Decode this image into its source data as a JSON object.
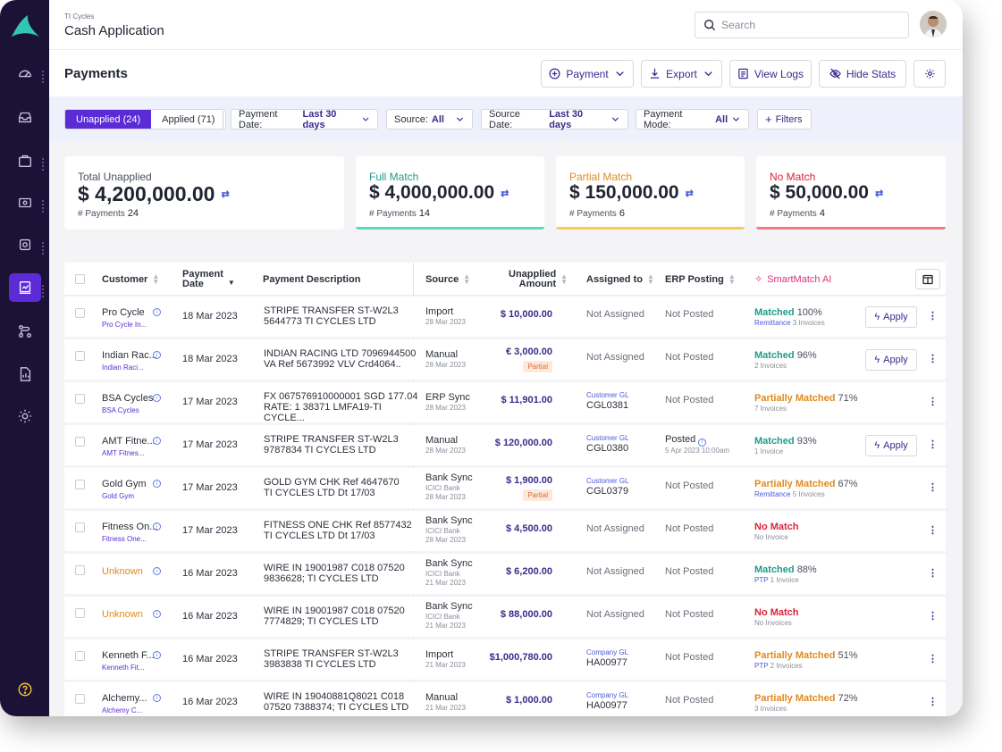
{
  "header": {
    "org": "TI Cycles",
    "title": "Cash Application",
    "search_placeholder": "Search"
  },
  "page": {
    "title": "Payments",
    "actions": {
      "payment": "Payment",
      "export": "Export",
      "view_logs": "View Logs",
      "hide_stats": "Hide Stats"
    }
  },
  "filters": {
    "tab_unapplied": "Unapplied (24)",
    "tab_applied": "Applied (71)",
    "payment_date_label": "Payment Date:",
    "payment_date_value": "Last 30 days",
    "source_label": "Source:",
    "source_value": "All",
    "source_date_label": "Source Date:",
    "source_date_value": "Last 30 days",
    "payment_mode_label": "Payment Mode:",
    "payment_mode_value": "All",
    "more_filters": "Filters"
  },
  "stats": [
    {
      "label": "Total Unapplied",
      "amount": "$ 4,200,000.00",
      "count_label": "# Payments",
      "count": "24",
      "color": "#4b4f5c"
    },
    {
      "label": "Full Match",
      "amount": "$ 4,000,000.00",
      "count_label": "# Payments",
      "count": "14",
      "color": "#1e9b8a"
    },
    {
      "label": "Partial Match",
      "amount": "$ 150,000.00",
      "count_label": "# Payments",
      "count": "6",
      "color": "#e08a1e"
    },
    {
      "label": "No Match",
      "amount": "$ 50,000.00",
      "count_label": "# Payments",
      "count": "4",
      "color": "#d8243a"
    }
  ],
  "table": {
    "headers": {
      "customer": "Customer",
      "payment_date_1": "Payment",
      "payment_date_2": "Date",
      "description": "Payment Description",
      "source": "Source",
      "unapplied_1": "Unapplied",
      "unapplied_2": "Amount",
      "assigned": "Assigned to",
      "erp": "ERP Posting",
      "smartmatch": "SmartMatch AI"
    },
    "apply_label": "Apply",
    "rows": [
      {
        "customer": "Pro Cycle",
        "customer_sub": "Pro Cycle In...",
        "date": "18 Mar 2023",
        "desc1": "STRIPE TRANSFER ST-W2L3",
        "desc2": "5644773 TI CYCLES LTD",
        "source": "Import",
        "source_sub": "",
        "source_date": "28 Mar 2023",
        "amount": "$ 10,000.00",
        "partial": "",
        "assigned_type": "",
        "assigned": "Not Assigned",
        "erp": "Not Posted",
        "erp_sub": "",
        "match": "Matched",
        "match_pct": "100%",
        "match_hl": "Remittance",
        "match_sub": "3 Invoices",
        "apply": true
      },
      {
        "customer": "Indian Rac...",
        "customer_sub": "Indian Raci...",
        "date": "18 Mar 2023",
        "desc1": "INDIAN RACING LTD 7096944500",
        "desc2": "VA Ref 5673992 VLV Crd4064..",
        "source": "Manual",
        "source_sub": "",
        "source_date": "28 Mar 2023",
        "amount": "€ 3,000.00",
        "partial": "Partial",
        "assigned_type": "",
        "assigned": "Not Assigned",
        "erp": "Not Posted",
        "erp_sub": "",
        "match": "Matched",
        "match_pct": "96%",
        "match_hl": "",
        "match_sub": "2 Invoices",
        "apply": true
      },
      {
        "customer": "BSA Cycles",
        "customer_sub": "BSA Cycles",
        "date": "17 Mar 2023",
        "desc1": "FX 067576910000001 SGD 177.04",
        "desc2": "RATE: 1 38371 LMFA19-TI CYCLE...",
        "source": "ERP Sync",
        "source_sub": "",
        "source_date": "28 Mar 2023",
        "amount": "$ 11,901.00",
        "partial": "",
        "assigned_type": "Customer GL",
        "assigned": "CGL0381",
        "erp": "Not Posted",
        "erp_sub": "",
        "match": "Partially Matched",
        "match_pct": "71%",
        "match_hl": "",
        "match_sub": "7 Invoices",
        "apply": false
      },
      {
        "customer": "AMT Fitne...",
        "customer_sub": "AMT Fitnes...",
        "date": "17 Mar 2023",
        "desc1": "STRIPE TRANSFER ST-W2L3",
        "desc2": "9787834 TI CYCLES LTD",
        "source": "Manual",
        "source_sub": "",
        "source_date": "28 Mar 2023",
        "amount": "$ 120,000.00",
        "partial": "",
        "assigned_type": "Customer GL",
        "assigned": "CGL0380",
        "erp": "Posted",
        "erp_sub": "5 Apr 2023 10:00am",
        "match": "Matched",
        "match_pct": "93%",
        "match_hl": "",
        "match_sub": "1 Invoice",
        "apply": true
      },
      {
        "customer": "Gold Gym",
        "customer_sub": "Gold Gym",
        "date": "17 Mar 2023",
        "desc1": "GOLD GYM CHK Ref 4647670",
        "desc2": "TI CYCLES LTD Dt 17/03",
        "source": "Bank Sync",
        "source_sub": "ICICI Bank",
        "source_date": "28 Mar 2023",
        "amount": "$ 1,900.00",
        "partial": "Partial",
        "assigned_type": "Customer GL",
        "assigned": "CGL0379",
        "erp": "Not Posted",
        "erp_sub": "",
        "match": "Partially Matched",
        "match_pct": "67%",
        "match_hl": "Remittance",
        "match_sub": "5 Invoices",
        "apply": false
      },
      {
        "customer": "Fitness On...",
        "customer_sub": "Fitness One...",
        "date": "17 Mar 2023",
        "desc1": "FITNESS ONE CHK Ref 8577432",
        "desc2": "TI CYCLES LTD Dt 17/03",
        "source": "Bank Sync",
        "source_sub": "ICICI Bank",
        "source_date": "28 Mar 2023",
        "amount": "$ 4,500.00",
        "partial": "",
        "assigned_type": "",
        "assigned": "Not Assigned",
        "erp": "Not Posted",
        "erp_sub": "",
        "match": "No Match",
        "match_pct": "",
        "match_hl": "",
        "match_sub": "No Invoice",
        "apply": false
      },
      {
        "customer": "Unknown",
        "customer_sub": "",
        "date": "16 Mar 2023",
        "desc1": "WIRE IN 19001987 C018 07520",
        "desc2": "9836628; TI CYCLES LTD",
        "source": "Bank Sync",
        "source_sub": "ICICI Bank",
        "source_date": "21 Mar 2023",
        "amount": "$ 6,200.00",
        "partial": "",
        "assigned_type": "",
        "assigned": "Not Assigned",
        "erp": "Not Posted",
        "erp_sub": "",
        "match": "Matched",
        "match_pct": "88%",
        "match_hl": "PTP",
        "match_sub": "1 Invoice",
        "apply": false
      },
      {
        "customer": "Unknown",
        "customer_sub": "",
        "date": "16 Mar 2023",
        "desc1": "WIRE IN 19001987 C018 07520",
        "desc2": "7774829; TI CYCLES LTD",
        "source": "Bank Sync",
        "source_sub": "ICICI Bank",
        "source_date": "21 Mar 2023",
        "amount": "$ 88,000.00",
        "partial": "",
        "assigned_type": "",
        "assigned": "Not Assigned",
        "erp": "Not Posted",
        "erp_sub": "",
        "match": "No Match",
        "match_pct": "",
        "match_hl": "",
        "match_sub": "No Invoices",
        "apply": false
      },
      {
        "customer": "Kenneth F...",
        "customer_sub": "Kenneth Fit...",
        "date": "16 Mar 2023",
        "desc1": "STRIPE TRANSFER ST-W2L3",
        "desc2": "3983838 TI CYCLES LTD",
        "source": "Import",
        "source_sub": "",
        "source_date": "21 Mar 2023",
        "amount": "$1,000,780.00",
        "partial": "",
        "assigned_type": "Company GL",
        "assigned": "HA00977",
        "erp": "Not Posted",
        "erp_sub": "",
        "match": "Partially Matched",
        "match_pct": "51%",
        "match_hl": "PTP",
        "match_sub": "2 Invoices",
        "apply": false
      },
      {
        "customer": "Alchemy...",
        "customer_sub": "Alchemy C...",
        "date": "16 Mar 2023",
        "desc1": "WIRE IN 19040881Q8021 C018",
        "desc2": "07520 7388374; TI CYCLES LTD",
        "source": "Manual",
        "source_sub": "",
        "source_date": "21 Mar 2023",
        "amount": "$ 1,000.00",
        "partial": "",
        "assigned_type": "Company GL",
        "assigned": "HA00977",
        "erp": "Not Posted",
        "erp_sub": "",
        "match": "Partially Matched",
        "match_pct": "72%",
        "match_hl": "",
        "match_sub": "3 Invoices",
        "apply": false
      }
    ]
  }
}
